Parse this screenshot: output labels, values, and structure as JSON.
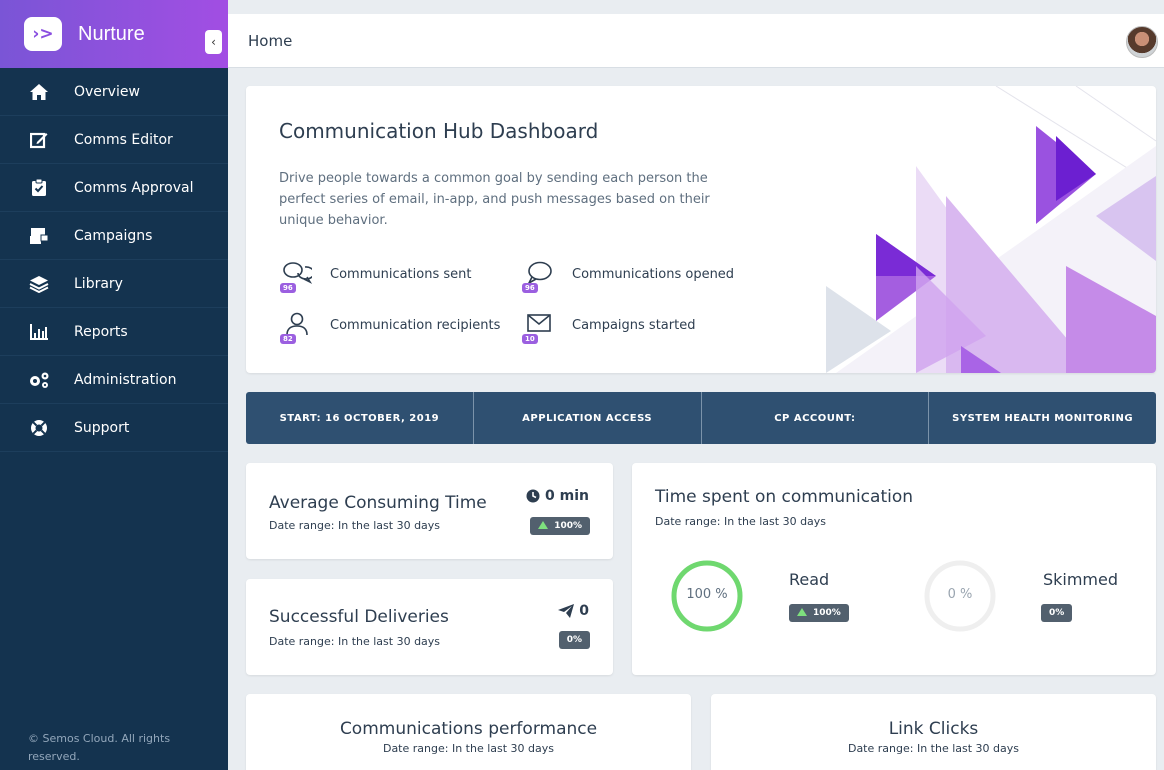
{
  "app": {
    "name": "Nurture",
    "logo_glyph": "›>",
    "collapse_glyph": "‹"
  },
  "header": {
    "title": "Home"
  },
  "sidebar": {
    "items": [
      {
        "label": "Overview",
        "icon": "home-icon"
      },
      {
        "label": "Comms Editor",
        "icon": "edit-icon"
      },
      {
        "label": "Comms Approval",
        "icon": "clipboard-check-icon"
      },
      {
        "label": "Campaigns",
        "icon": "campaigns-icon"
      },
      {
        "label": "Library",
        "icon": "layers-icon"
      },
      {
        "label": "Reports",
        "icon": "bar-chart-icon"
      },
      {
        "label": "Administration",
        "icon": "gears-icon"
      },
      {
        "label": "Support",
        "icon": "lifebuoy-icon"
      }
    ],
    "footer": "© Semos Cloud. All rights reserved."
  },
  "hero": {
    "title": "Communication Hub Dashboard",
    "description": "Drive people towards a common goal by sending each person the perfect series of email, in-app, and push messages based on their unique behavior.",
    "stats": [
      {
        "label": "Communications sent",
        "badge": "96",
        "icon": "chat-bubbles-icon"
      },
      {
        "label": "Communications opened",
        "badge": "96",
        "icon": "chat-bubble-icon"
      },
      {
        "label": "Communication recipients",
        "badge": "82",
        "icon": "user-icon"
      },
      {
        "label": "Campaigns started",
        "badge": "10",
        "icon": "envelope-icon"
      }
    ]
  },
  "infobar": [
    "START: 16 OCTOBER, 2019",
    "APPLICATION ACCESS",
    "CP ACCOUNT:",
    "SYSTEM HEALTH MONITORING"
  ],
  "avg_time": {
    "title": "Average Consuming Time",
    "subtitle": "Date range: In the last 30 days",
    "value": "0 min",
    "change": "100%"
  },
  "deliveries": {
    "title": "Successful Deliveries",
    "subtitle": "Date range: In the last 30 days",
    "value": "0",
    "change": "0%"
  },
  "time_spent": {
    "title": "Time spent on communication",
    "subtitle": "Date range: In the last 30 days",
    "read": {
      "label": "Read",
      "percent": "100 %",
      "change": "100%",
      "fraction": 1.0,
      "color": "#6fd86f"
    },
    "skimmed": {
      "label": "Skimmed",
      "percent": "0 %",
      "change": "0%",
      "fraction": 0.0,
      "color": "#efefef"
    }
  },
  "performance": {
    "title": "Communications performance",
    "subtitle": "Date range: In the last 30 days"
  },
  "link_clicks": {
    "title": "Link Clicks",
    "subtitle": "Date range: In the last 30 days"
  },
  "colors": {
    "sidebar": "#14334f",
    "brand_start": "#7a55d6",
    "brand_end": "#a24ee3",
    "infobar": "#2f5071",
    "accent_purple": "#9b5fe0"
  }
}
